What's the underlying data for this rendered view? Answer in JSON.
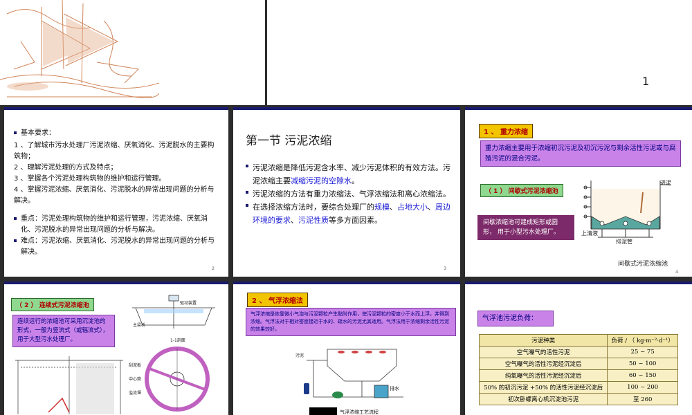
{
  "slide1": {
    "page_number": "1"
  },
  "slide2": {
    "intro": "基本要求：",
    "items": [
      "1 、了解城市污水处理厂污泥浓缩、厌氧消化、污泥脱水的主要构筑物；",
      "2 、理解污泥处理的方式及特点；",
      "3 、掌握各个污泥处理构筑物的维护和运行管理。",
      "4 、掌握污泥浓缩、厌氧消化、污泥脱水的异常出现问题的分析与解决。"
    ],
    "key": "重点：污泥处理构筑物的维护和运行管理，污泥浓缩、厌氧消化、污泥脱水的异常出现问题的分析与解决。",
    "difficult": "难点：污泥浓缩、厌氧消化、污泥脱水的异常出现问题的分析与解决。",
    "page_number": "2"
  },
  "slide3": {
    "title": "第一节  污泥浓缩",
    "b1_pre": "污泥浓缩是降低污泥含水率、减少污泥体积的有效方法。污泥浓缩主要",
    "b1_hl": "减缩污泥的空隙水",
    "b1_post": "。",
    "b2": "污泥浓缩的方法有重力浓缩法、气浮浓缩法和离心浓缩法。",
    "b3_pre": "在选择浓缩方法时，要综合处理厂的",
    "b3_hl1": "规模",
    "b3_sep1": "、",
    "b3_hl2": "占地大小",
    "b3_sep2": "、",
    "b3_hl3": "周边环境的要求",
    "b3_sep3": "、",
    "b3_hl4": "污泥性质",
    "b3_post": "等多方面因素。",
    "page_number": "3"
  },
  "slide4": {
    "label": "1 、 重力浓缩",
    "desc": "重力浓缩主要用于浓缩初沉污泥及初沉污泥与剩余活性污泥或与腐殖污泥的混合污泥。",
    "sub_label": "（ 1 ） 间歇式污泥浓缩池",
    "note": "间歇浓缩池可建成矩形或圆形， 用于小型污水处理厂。",
    "lbl_inlet": "进泥",
    "lbl_supernatant": "上清液",
    "lbl_outlet": "排泥管",
    "caption": "间歇式污泥浓缩池",
    "page_number": "4"
  },
  "slide5": {
    "label": "（ 2 ） 连续式污泥浓缩池",
    "note": "连续运行的浓缩池可采用沉淀池的形式，一般为竖流式（或辐流式），用于大型污水处理厂。",
    "lbl_drive": "驱动装置",
    "lbl_bridge": "主梁桥",
    "lbl_center": "中心筒",
    "lbl_scraper": "刮泥板",
    "lbl_overflow": "溢流堰",
    "lbl_section": "1-1剖面"
  },
  "slide6": {
    "label": "2 、 气浮浓缩法",
    "desc": "气浮浓缩是依靠微小气泡与污泥颗粒产生黏附作用，使污泥颗粒的密度小于水而上浮，并得到浓缩。气浮法对于相对密度接近于水的、疏水的污泥尤其适用。气浮法用于浓缩剩余活性污泥的效果较好。",
    "lbl_sludge": "污泥",
    "lbl_drain": "排水",
    "caption": "气浮浓缩工艺流程"
  },
  "slide7": {
    "title": "气浮池污泥负荷：",
    "headers": [
      "污泥种类",
      "负荷 / （ kg·m⁻²·d⁻¹）"
    ],
    "rows": [
      [
        "空气曝气的活性污泥",
        "25 ~ 75"
      ],
      [
        "空气曝气的活性污泥经沉淀后",
        "50 ~ 100"
      ],
      [
        "纯氧曝气的活性污泥经沉淀后",
        "60 ~ 150"
      ],
      [
        "50% 的初沉污泥 +50% 的活性污泥经沉淀后",
        "100 ~ 200"
      ],
      [
        "初次卧螺离心机沉淀池污泥",
        "至 260"
      ]
    ]
  },
  "colors": {
    "slide_label_yellow": "#f3c400",
    "slide_label_green": "#8fd88f",
    "purple_box": "#c982e8",
    "maroon_box": "#7d2a6a",
    "link_blue": "#1a1ad6"
  }
}
